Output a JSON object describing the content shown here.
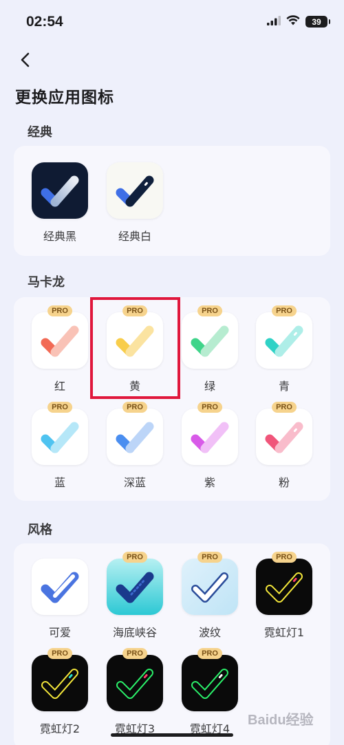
{
  "status_bar": {
    "time": "02:54",
    "battery": "39"
  },
  "header": {
    "title": "更换应用图标"
  },
  "sections": {
    "classic": {
      "title": "经典",
      "items": [
        {
          "label": "经典黑",
          "pro": false
        },
        {
          "label": "经典白",
          "pro": false
        }
      ]
    },
    "macaron": {
      "title": "马卡龙",
      "items": [
        {
          "label": "红",
          "pro": true,
          "color": "#f26a55"
        },
        {
          "label": "黄",
          "pro": true,
          "color": "#f8cd4a"
        },
        {
          "label": "绿",
          "pro": true,
          "color": "#3fd48a"
        },
        {
          "label": "青",
          "pro": true,
          "color": "#2fd2c6"
        },
        {
          "label": "蓝",
          "pro": true,
          "color": "#4fc3f0"
        },
        {
          "label": "深蓝",
          "pro": true,
          "color": "#4a8ef0"
        },
        {
          "label": "紫",
          "pro": true,
          "color": "#d85ae8"
        },
        {
          "label": "粉",
          "pro": true,
          "color": "#f0557a"
        }
      ]
    },
    "style": {
      "title": "风格",
      "items": [
        {
          "label": "可爱",
          "pro": false
        },
        {
          "label": "海底峡谷",
          "pro": true
        },
        {
          "label": "波纹",
          "pro": true
        },
        {
          "label": "霓虹灯1",
          "pro": true
        },
        {
          "label": "霓虹灯2",
          "pro": true
        },
        {
          "label": "霓虹灯3",
          "pro": true
        },
        {
          "label": "霓虹灯4",
          "pro": true
        }
      ]
    }
  },
  "pro_label": "PRO",
  "watermark": "Baidu经验"
}
